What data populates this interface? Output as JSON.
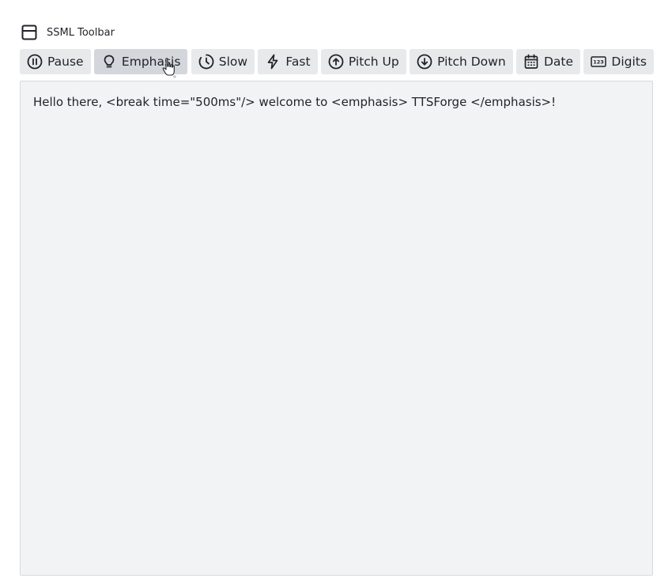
{
  "header": {
    "title": "SSML Toolbar",
    "icon": "panel-icon"
  },
  "toolbar": {
    "active_index": 1,
    "buttons": [
      {
        "label": "Pause",
        "icon": "pause-circle-icon"
      },
      {
        "label": "Emphasis",
        "icon": "lightbulb-icon"
      },
      {
        "label": "Slow",
        "icon": "clock-icon"
      },
      {
        "label": "Fast",
        "icon": "lightning-icon"
      },
      {
        "label": "Pitch Up",
        "icon": "arrow-up-circle-icon"
      },
      {
        "label": "Pitch Down",
        "icon": "arrow-down-circle-icon"
      },
      {
        "label": "Date",
        "icon": "calendar-icon"
      },
      {
        "label": "Digits",
        "icon": "digits-icon"
      }
    ]
  },
  "editor": {
    "content": "Hello there, <break time=\"500ms\"/> welcome to <emphasis> TTSForge </emphasis>!"
  },
  "colors": {
    "button_bg": "#e8e9eb",
    "button_active_bg": "#d3d6db",
    "editor_bg": "#f2f3f4",
    "text": "#1f2328"
  }
}
